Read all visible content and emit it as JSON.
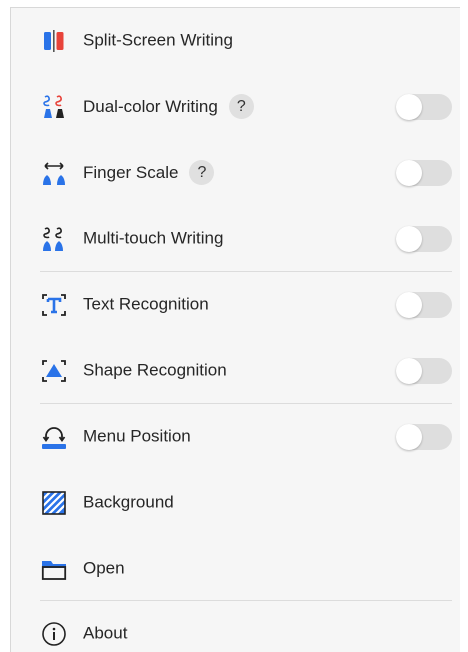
{
  "menu": {
    "items": [
      {
        "label": "Split-Screen Writing",
        "icon": "split-screen-icon",
        "has_help": false,
        "has_toggle": false
      },
      {
        "label": "Dual-color Writing",
        "icon": "dual-color-icon",
        "has_help": true,
        "has_toggle": true,
        "toggle_on": false
      },
      {
        "label": "Finger Scale",
        "icon": "finger-scale-icon",
        "has_help": true,
        "has_toggle": true,
        "toggle_on": false
      },
      {
        "label": "Multi-touch Writing",
        "icon": "multi-touch-icon",
        "has_help": false,
        "has_toggle": true,
        "toggle_on": false
      },
      {
        "label": "Text Recognition",
        "icon": "text-recognition-icon",
        "has_help": false,
        "has_toggle": true,
        "toggle_on": false
      },
      {
        "label": "Shape Recognition",
        "icon": "shape-recognition-icon",
        "has_help": false,
        "has_toggle": true,
        "toggle_on": false
      },
      {
        "label": "Menu Position",
        "icon": "menu-position-icon",
        "has_help": false,
        "has_toggle": true,
        "toggle_on": false
      },
      {
        "label": "Background",
        "icon": "background-icon",
        "has_help": false,
        "has_toggle": false
      },
      {
        "label": "Open",
        "icon": "folder-icon",
        "has_help": false,
        "has_toggle": false
      },
      {
        "label": "About",
        "icon": "info-icon",
        "has_help": false,
        "has_toggle": false
      }
    ],
    "help_glyph": "?"
  },
  "colors": {
    "accent_blue": "#2a73e8",
    "accent_red": "#e8433a",
    "icon_dark": "#222222",
    "toggle_off": "#dedede",
    "panel_bg": "#f6f6f6"
  }
}
